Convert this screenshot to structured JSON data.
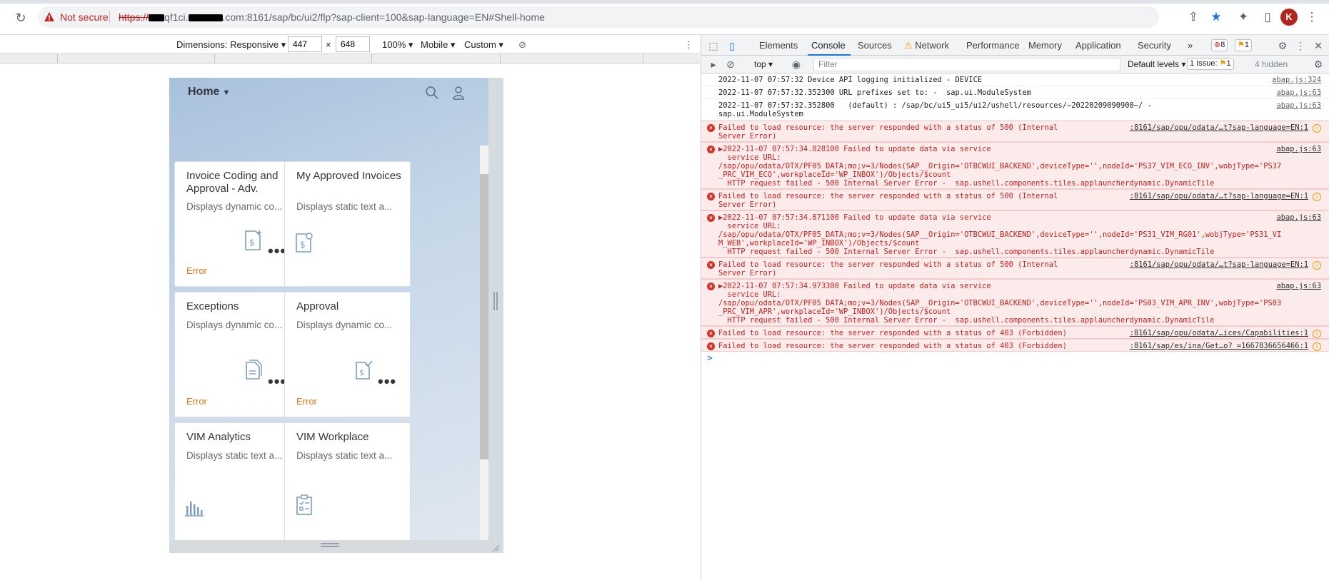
{
  "browser": {
    "security_label": "Not secure",
    "url_scheme": "https://",
    "url_host_part": "qf1ci.",
    "url_rest": ".com:8161/sap/bc/ui2/flp?sap-client=100&sap-language=EN#Shell-home",
    "avatar_letter": "K"
  },
  "emulation": {
    "dimensions_label": "Dimensions: Responsive",
    "width": "447",
    "times": "×",
    "height": "648",
    "zoom": "100%",
    "throttle": "Mobile",
    "custom": "Custom"
  },
  "app": {
    "home_label": "Home",
    "tiles": [
      {
        "title": "Invoice Coding and Approval - Adv.",
        "subtitle": "Displays dynamic co...",
        "status": "Error"
      },
      {
        "title": "My Approved Invoices",
        "subtitle": "Displays static text a...",
        "status": ""
      },
      {
        "title": "Exceptions",
        "subtitle": "Displays dynamic co...",
        "status": "Error"
      },
      {
        "title": "Approval",
        "subtitle": "Displays dynamic co...",
        "status": "Error"
      },
      {
        "title": "VIM Analytics",
        "subtitle": "Displays static text a...",
        "status": ""
      },
      {
        "title": "VIM Workplace",
        "subtitle": "Displays static text a...",
        "status": ""
      }
    ],
    "more_glyph": "•••"
  },
  "devtools": {
    "tabs": [
      "Elements",
      "Console",
      "Sources",
      "Network",
      "Performance",
      "Memory",
      "Application",
      "Security"
    ],
    "more_tabs": "»",
    "error_count": "8",
    "warning_count": "1",
    "context": "top",
    "filter_placeholder": "Filter",
    "levels": "Default levels",
    "issues": "1 Issue:",
    "issues_count": "1",
    "hidden": "4 hidden",
    "prompt": ">",
    "messages": [
      {
        "level": "info",
        "text": "2022-11-07 07:57:32 Device API logging initialized - DEVICE",
        "source": "abap.js:324"
      },
      {
        "level": "info",
        "text": "2022-11-07 07:57:32.352300 URL prefixes set to: -  sap.ui.ModuleSystem",
        "source": "abap.js:63"
      },
      {
        "level": "info",
        "text": "2022-11-07 07:57:32.352800   (default) : /sap/bc/ui5_ui5/ui2/ushell/resources/~20220209090900~/ -\nsap.ui.ModuleSystem",
        "source": "abap.js:63"
      },
      {
        "level": "error",
        "text": "Failed to load resource: the server responded with a status of 500 (Internal\nServer Error)",
        "source": ":8161/sap/opu/odata/…t?sap-language=EN:1"
      },
      {
        "level": "error",
        "text": "▶2022-11-07 07:57:34.828100 Failed to update data via service\n  service URL:\n/sap/opu/odata/OTX/PF05_DATA;mo;v=3/Nodes(SAP__Origin='OTBCWUI_BACKEND',deviceType='',nodeId='PS37_VIM_ECO_INV',wobjType='PS37\n_PRC_VIM_ECO',workplaceId='WP_INBOX')/Objects/$count\n  HTTP request failed - 500 Internal Server Error -  sap.ushell.components.tiles.applauncherdynamic.DynamicTile",
        "source": "abap.js:63"
      },
      {
        "level": "error",
        "text": "Failed to load resource: the server responded with a status of 500 (Internal\nServer Error)",
        "source": ":8161/sap/opu/odata/…t?sap-language=EN:1"
      },
      {
        "level": "error",
        "text": "▶2022-11-07 07:57:34.871100 Failed to update data via service\n  service URL:\n/sap/opu/odata/OTX/PF05_DATA;mo;v=3/Nodes(SAP__Origin='OTBCWUI_BACKEND',deviceType='',nodeId='PS31_VIM_RG01',wobjType='PS31_VI\nM_WEB',workplaceId='WP_INBOX')/Objects/$count\n  HTTP request failed - 500 Internal Server Error -  sap.ushell.components.tiles.applauncherdynamic.DynamicTile",
        "source": "abap.js:63"
      },
      {
        "level": "error",
        "text": "Failed to load resource: the server responded with a status of 500 (Internal\nServer Error)",
        "source": ":8161/sap/opu/odata/…t?sap-language=EN:1"
      },
      {
        "level": "error",
        "text": "▶2022-11-07 07:57:34.973300 Failed to update data via service\n  service URL:\n/sap/opu/odata/OTX/PF05_DATA;mo;v=3/Nodes(SAP__Origin='OTBCWUI_BACKEND',deviceType='',nodeId='PS03_VIM_APR_INV',wobjType='PS03\n_PRC_VIM_APR',workplaceId='WP_INBOX')/Objects/$count\n  HTTP request failed - 500 Internal Server Error -  sap.ushell.components.tiles.applauncherdynamic.DynamicTile",
        "source": "abap.js:63"
      },
      {
        "level": "error",
        "text": "Failed to load resource: the server responded with a status of 403 (Forbidden)",
        "source": ":8161/sap/opu/odata/…ices/Capabilities:1"
      },
      {
        "level": "error",
        "text": "Failed to load resource: the server responded with a status of 403 (Forbidden)",
        "source": ":8161/sap/es/ina/Get…o? =1667836656466:1"
      }
    ]
  }
}
